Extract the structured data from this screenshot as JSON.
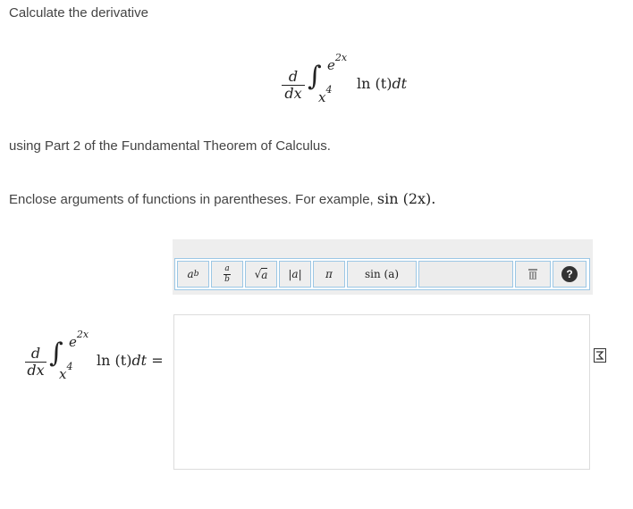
{
  "prompt": {
    "line1": "Calculate the derivative",
    "line2": "using Part 2 of the Fundamental Theorem of Calculus.",
    "line3_text": "Enclose arguments of functions in parentheses. For example, ",
    "line3_math": "sin (2x)."
  },
  "expression": {
    "d": "d",
    "dx": "dx",
    "upper_base": "e",
    "upper_exp": "2x",
    "lower_base": "x",
    "lower_exp": "4",
    "integrand_fn": "ln",
    "integrand_arg": "(t)",
    "integrand_dt": "dt",
    "equals": "="
  },
  "toolbar": {
    "power_base": "a",
    "power_exp": "b",
    "frac_num": "a",
    "frac_den": "b",
    "sqrt_symbol": "√",
    "sqrt_arg": "a",
    "abs_label": "|a|",
    "pi_label": "π",
    "sin_label": "sin (a)",
    "help_label": "?"
  },
  "icons": {
    "trash": "trash-icon",
    "help": "help-icon",
    "formula": "formula-icon"
  }
}
